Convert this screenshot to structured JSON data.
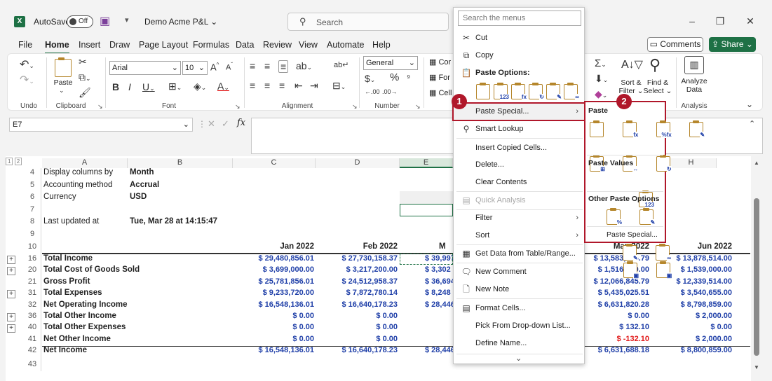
{
  "titlebar": {
    "autosave_label": "AutoSave",
    "autosave_state": "Off",
    "file_name": "Demo Acme P&L",
    "search_placeholder": "Search",
    "minimize": "–",
    "restore": "❐",
    "close": "✕"
  },
  "menu_tabs": [
    "File",
    "Home",
    "Insert",
    "Draw",
    "Page Layout",
    "Formulas",
    "Data",
    "Review",
    "View",
    "Automate",
    "Help"
  ],
  "active_tab": "Home",
  "header_buttons": {
    "comments": "Comments",
    "share": "Share"
  },
  "ribbon": {
    "undo_label": "Undo",
    "clipboard_label": "Clipboard",
    "paste_label": "Paste",
    "font_label": "Font",
    "font_name": "Arial",
    "font_size": "10",
    "alignment_label": "Alignment",
    "number_label": "Number",
    "number_format": "General",
    "percent": "%",
    "sort_filter_1": "Sort &",
    "sort_filter_2": "Filter",
    "find_select_1": "Find &",
    "find_select_2": "Select",
    "analyze_1": "Analyze",
    "analyze_2": "Data",
    "analysis_label": "Analysis",
    "cells_items": [
      "Cor",
      "For",
      "Cell"
    ]
  },
  "formula_bar": {
    "name_box": "E7",
    "fx": "fx"
  },
  "columns": [
    "A",
    "B",
    "C",
    "D",
    "E",
    "H"
  ],
  "info_rows": [
    {
      "row": "4",
      "label": "Display columns by",
      "value": "Month"
    },
    {
      "row": "5",
      "label": "Accounting method",
      "value": "Accrual"
    },
    {
      "row": "6",
      "label": "Currency",
      "value": "USD"
    },
    {
      "row": "7",
      "label": "",
      "value": ""
    },
    {
      "row": "8",
      "label": "Last updated at",
      "value": "Tue, Mar 28 at 14:15:47"
    },
    {
      "row": "9",
      "label": "",
      "value": ""
    }
  ],
  "header_row": {
    "row": "10",
    "c": "Jan 2022",
    "d": "Feb 2022",
    "e": "M",
    "g": "May 2022",
    "h": "Jun 2022"
  },
  "data_rows": [
    {
      "row": "16",
      "label": "Total Income",
      "c": "$ 29,480,856.01",
      "d": "$ 27,730,158.37",
      "e": "$ 39,997",
      "g": "$ 13,583,645.79",
      "h": "$ 13,878,514.00",
      "expand": true
    },
    {
      "row": "20",
      "label": "Total Cost of Goods Sold",
      "c": "$ 3,699,000.00",
      "d": "$ 3,217,200.00",
      "e": "$ 3,302",
      "g": "$ 1,516,800.00",
      "h": "$ 1,539,000.00",
      "expand": true
    },
    {
      "row": "21",
      "label": "Gross Profit",
      "c": "$ 25,781,856.01",
      "d": "$ 24,512,958.37",
      "e": "$ 36,694",
      "g": "$ 12,066,845.79",
      "h": "$ 12,339,514.00",
      "expand": false
    },
    {
      "row": "31",
      "label": "Total Expenses",
      "c": "$ 9,233,720.00",
      "d": "$ 7,872,780.14",
      "e": "$ 8,248",
      "g": "$ 5,435,025.51",
      "h": "$ 3,540,655.00",
      "expand": true
    },
    {
      "row": "32",
      "label": "Net Operating Income",
      "c": "$ 16,548,136.01",
      "d": "$ 16,640,178.23",
      "e": "$ 28,446",
      "g": "$ 6,631,820.28",
      "h": "$ 8,798,859.00",
      "expand": false
    },
    {
      "row": "36",
      "label": "Total Other Income",
      "c": "$ 0.00",
      "d": "$ 0.00",
      "e": "",
      "g": "$ 0.00",
      "h": "$ 2,000.00",
      "expand": true
    },
    {
      "row": "40",
      "label": "Total Other Expenses",
      "c": "$ 0.00",
      "d": "$ 0.00",
      "e": "",
      "g": "$ 132.10",
      "h": "$ 0.00",
      "expand": true
    },
    {
      "row": "41",
      "label": "Net Other Income",
      "c": "$ 0.00",
      "d": "$ 0.00",
      "e": "",
      "g": "$ -132.10",
      "h": "$ 2,000.00",
      "expand": false,
      "g_red": true
    },
    {
      "row": "42",
      "label": "Net Income",
      "c": "$ 16,548,136.01",
      "d": "$ 16,640,178.23",
      "e": "$ 28,446",
      "g": "$ 6,631,688.18",
      "h": "$ 8,800,859.00",
      "expand": false
    }
  ],
  "last_row": "43",
  "context_menu": {
    "search_placeholder": "Search the menus",
    "cut": "Cut",
    "copy": "Copy",
    "paste_options": "Paste Options:",
    "paste_special": "Paste Special...",
    "smart_lookup": "Smart Lookup",
    "insert_copied": "Insert Copied Cells...",
    "delete": "Delete...",
    "clear_contents": "Clear Contents",
    "quick_analysis": "Quick Analysis",
    "filter": "Filter",
    "sort": "Sort",
    "get_data": "Get Data from Table/Range...",
    "new_comment": "New Comment",
    "new_note": "New Note",
    "format_cells": "Format Cells...",
    "pick_list": "Pick From Drop-down List...",
    "define_name": "Define Name...",
    "more": "⌄"
  },
  "submenu": {
    "paste": "Paste",
    "paste_values": "Paste Values",
    "other_paste_options": "Other Paste Options",
    "paste_special": "Paste Special..."
  },
  "badges": {
    "one": "1",
    "two": "2"
  },
  "colors": {
    "excel_green": "#1e7145",
    "number_blue": "#1f3fa8",
    "negative_red": "#e11919",
    "callout_red": "#b0172a"
  }
}
